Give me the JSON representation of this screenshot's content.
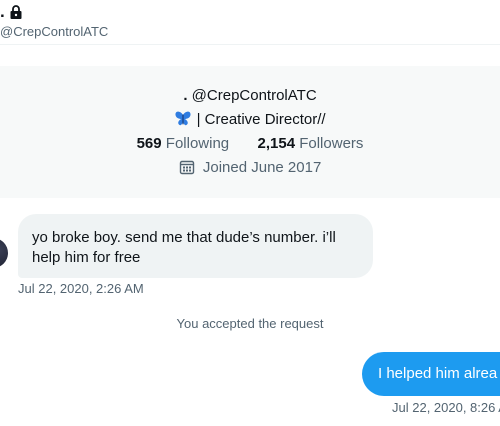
{
  "header": {
    "name": ".",
    "handle": "@CrepControlATC",
    "lock_icon": "lock-icon"
  },
  "profile": {
    "name_dot": ".",
    "handle": "@CrepControlATC",
    "bio_emoji_icon": "butterfly-icon",
    "bio": "| Creative Director//",
    "following_count": "569",
    "following_label": "Following",
    "followers_count": "2,154",
    "followers_label": "Followers",
    "calendar_icon": "calendar-icon",
    "joined": "Joined June 2017"
  },
  "messages": {
    "incoming": {
      "text": "yo broke boy. send me that dude’s number. i’ll help him for free",
      "time": "Jul 22, 2020, 2:26 AM"
    },
    "system": "You accepted the request",
    "outgoing": {
      "text": "I helped him alrea",
      "time": "Jul 22, 2020, 8:26 A"
    }
  },
  "colors": {
    "accent": "#1d9bf0",
    "bubble_incoming": "#eff3f4",
    "secondary_text": "#536471",
    "card_bg": "#f7f9f9"
  }
}
